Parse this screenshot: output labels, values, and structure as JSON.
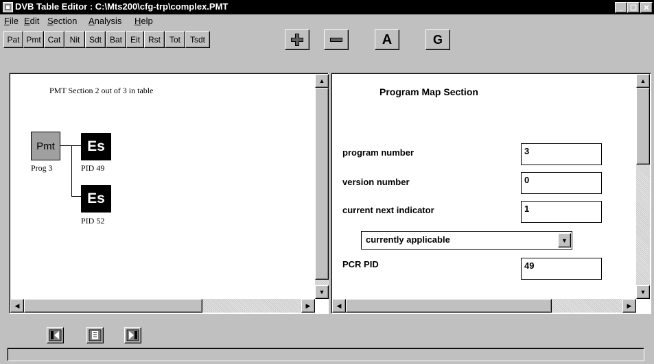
{
  "window": {
    "title": "DVB Table Editor : C:\\Mts200\\cfg-trp\\complex.PMT",
    "controls": [
      "minimize",
      "maximize",
      "close"
    ]
  },
  "menu": [
    {
      "label": "File",
      "mnemonic": "F"
    },
    {
      "label": "Edit",
      "mnemonic": "E"
    },
    {
      "label": "Section",
      "mnemonic": "S"
    },
    {
      "label": "Analysis",
      "mnemonic": "A"
    },
    {
      "label": "Help",
      "mnemonic": "H"
    }
  ],
  "toolbar": {
    "tables": [
      "Pat",
      "Pmt",
      "Cat",
      "Nit",
      "Sdt",
      "Bat",
      "Eit",
      "Rst",
      "Tot",
      "Tsdt"
    ],
    "add_icon": "plus-icon",
    "remove_icon": "minus-icon",
    "a_label": "A",
    "g_label": "G"
  },
  "tree": {
    "caption": "PMT Section 2 out of 3 in table",
    "pmt_node": {
      "label": "Pmt",
      "sublabel": "Prog 3"
    },
    "es_nodes": [
      {
        "label": "Es",
        "sublabel": "PID 49"
      },
      {
        "label": "Es",
        "sublabel": "PID 52"
      }
    ]
  },
  "form": {
    "title": "Program Map Section",
    "fields": [
      {
        "label": "program number",
        "value": "3"
      },
      {
        "label": "version number",
        "value": "0"
      },
      {
        "label": "current next indicator",
        "value": "1"
      }
    ],
    "applicability_select": "currently applicable",
    "pcr_pid": {
      "label": "PCR PID",
      "value": "49"
    }
  },
  "nav_icons": [
    "first-section-icon",
    "section-list-icon",
    "last-section-icon"
  ],
  "status": "",
  "colors": {
    "titlebar": "#000000",
    "chrome": "#c0c0c0",
    "node_pmt": "#a0a0a0",
    "node_es": "#000000"
  }
}
